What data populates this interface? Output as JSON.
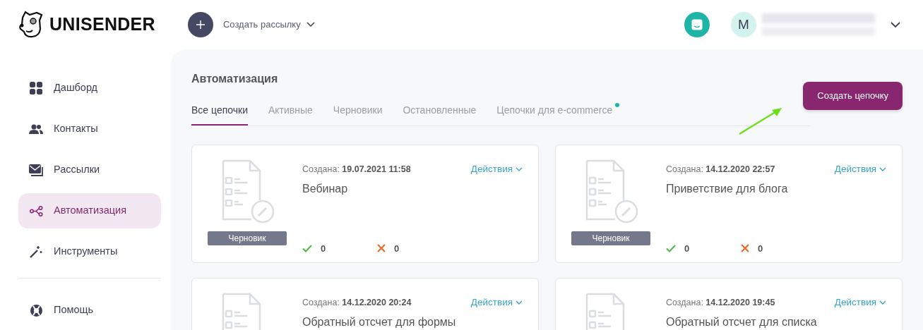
{
  "header": {
    "logo": "UNISENDER",
    "create_mailing": "Создать рассылку",
    "avatar_letter": "M"
  },
  "sidebar": {
    "items": [
      {
        "label": "Дашборд",
        "kind": "grid",
        "selected": false
      },
      {
        "label": "Контакты",
        "kind": "people",
        "selected": false
      },
      {
        "label": "Рассылки",
        "kind": "mail",
        "selected": false
      },
      {
        "label": "Автоматизация",
        "kind": "share",
        "selected": true
      },
      {
        "label": "Инструменты",
        "kind": "wand",
        "selected": false
      }
    ],
    "bottom_items": [
      {
        "label": "Помощь",
        "kind": "help",
        "selected": false
      }
    ]
  },
  "page": {
    "title": "Автоматизация",
    "create_button": "Создать цепочку",
    "tabs": [
      {
        "label": "Все цепочки",
        "selected": true,
        "notification": false
      },
      {
        "label": "Активные",
        "selected": false,
        "notification": false
      },
      {
        "label": "Черновики",
        "selected": false,
        "notification": false
      },
      {
        "label": "Остановленные",
        "selected": false,
        "notification": false
      },
      {
        "label": "Цепочки для e-commerce",
        "selected": false,
        "notification": true
      }
    ],
    "chains": [
      {
        "created_label": "Создана:",
        "created": "19.07.2021 11:58",
        "actions": "Действия",
        "name": "Вебинар",
        "status": "Черновик",
        "sent": "0",
        "failed": "0"
      },
      {
        "created_label": "Создана:",
        "created": "14.12.2020 22:57",
        "actions": "Действия",
        "name": "Приветствие для блога",
        "status": "Черновик",
        "sent": "0",
        "failed": "0"
      },
      {
        "created_label": "Создана:",
        "created": "14.12.2020 20:24",
        "actions": "Действия",
        "name": "Обратный отсчет для формы"
      },
      {
        "created_label": "Создана:",
        "created": "14.12.2020 19:45",
        "actions": "Действия",
        "name": "Обратный отсчет для списка"
      }
    ]
  }
}
